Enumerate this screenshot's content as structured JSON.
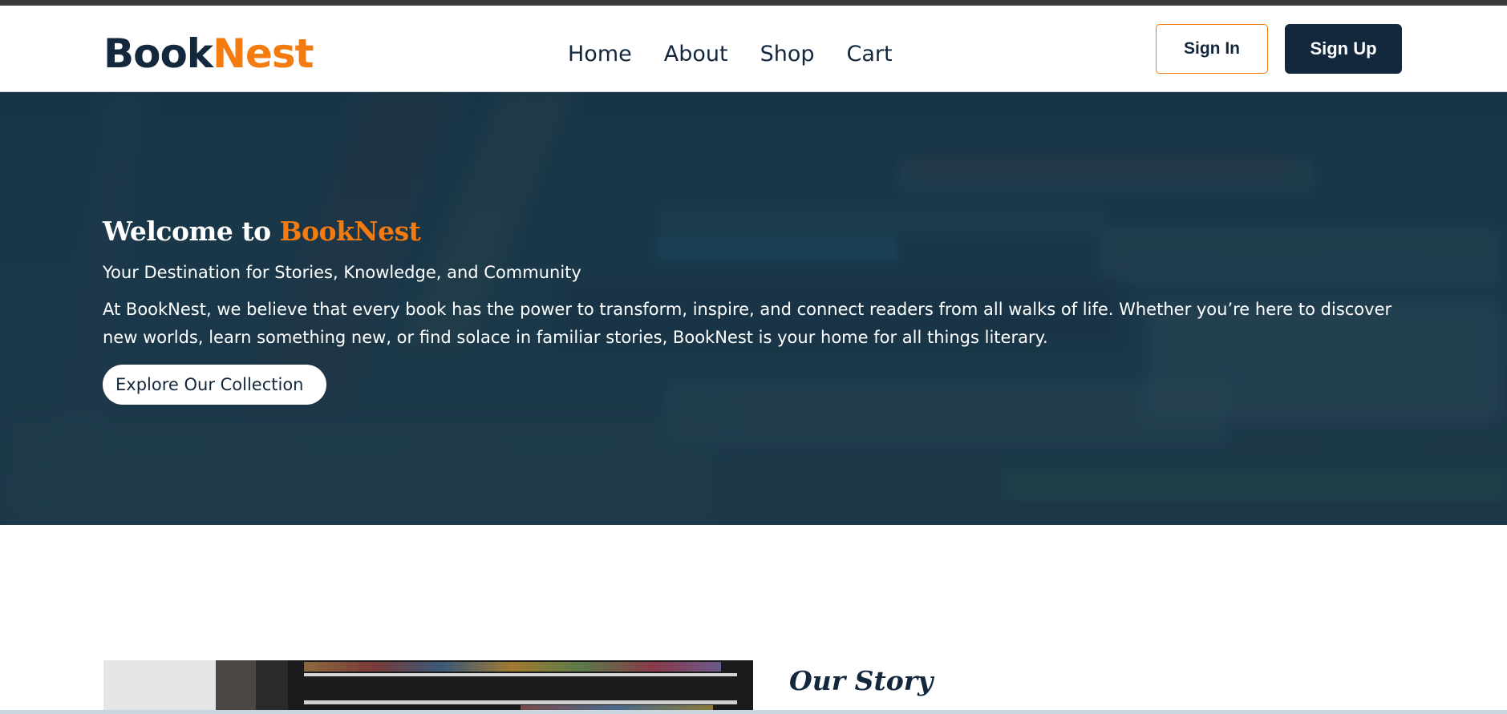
{
  "header": {
    "logo": {
      "part1": "Book",
      "part2": "Nest"
    },
    "nav": [
      {
        "label": "Home"
      },
      {
        "label": "About"
      },
      {
        "label": "Shop"
      },
      {
        "label": "Cart"
      }
    ],
    "sign_in_label": "Sign In",
    "sign_up_label": "Sign Up"
  },
  "hero": {
    "title_prefix": "Welcome to ",
    "title_brand": "BookNest",
    "subtitle": "Your Destination for Stories, Knowledge, and Community",
    "body": "At BookNest, we believe that every book has the power to transform, inspire, and connect readers from all walks of life. Whether you’re here to discover new worlds, learn something new, or find solace in familiar stories, BookNest is your home for all things literary.",
    "cta_label": "Explore Our Collection"
  },
  "story": {
    "title": "Our Story"
  },
  "colors": {
    "brand_navy": "#13273d",
    "brand_orange": "#f47b10"
  }
}
